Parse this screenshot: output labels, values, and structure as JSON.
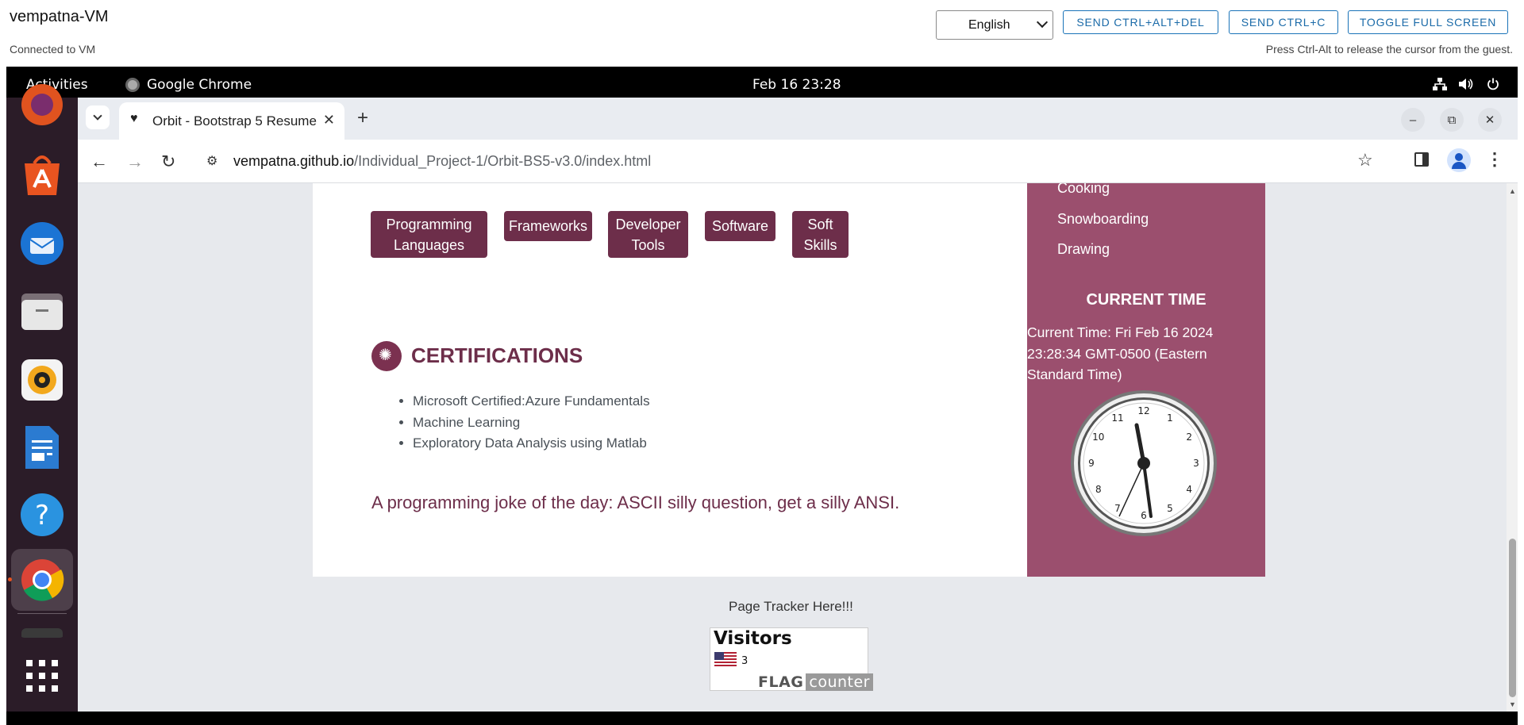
{
  "vm": {
    "title": "vempatna-VM",
    "status": "Connected to VM",
    "language": "English",
    "buttons": {
      "ctrl_alt_del": "SEND CTRL+ALT+DEL",
      "ctrl_c": "SEND CTRL+C",
      "fullscreen": "TOGGLE FULL SCREEN"
    },
    "hint": "Press Ctrl-Alt to release the cursor from the guest."
  },
  "topbar": {
    "activities": "Activities",
    "app_name": "Google Chrome",
    "datetime": "Feb 16  23:28"
  },
  "dock": {
    "items": [
      "firefox-icon",
      "app-center-icon",
      "thunderbird-icon",
      "files-icon",
      "rhythmbox-icon",
      "writer-icon",
      "help-icon",
      "chrome-icon",
      "terminal-icon",
      "app-grid-icon"
    ]
  },
  "browser": {
    "tab_title": "Orbit - Bootstrap 5 Resume",
    "url_host": "vempatna.github.io",
    "url_path": "/Individual_Project-1/Orbit-BS5-v3.0/index.html"
  },
  "page": {
    "skills": [
      {
        "line1": "Programming",
        "line2": "Languages"
      },
      {
        "line1": "Frameworks",
        "line2": ""
      },
      {
        "line1": "Developer",
        "line2": "Tools"
      },
      {
        "line1": "Software",
        "line2": ""
      },
      {
        "line1": "Soft",
        "line2": "Skills"
      }
    ],
    "certifications_heading": "CERTIFICATIONS",
    "certifications": [
      "Microsoft Certified:Azure Fundamentals",
      "Machine Learning",
      "Exploratory Data Analysis using Matlab"
    ],
    "joke": "A programming joke of the day: ASCII silly question, get a silly ANSI.",
    "hobbies": [
      "Cooking",
      "Snowboarding",
      "Drawing"
    ],
    "current_time_heading": "CURRENT TIME",
    "current_time_text": "Current Time: Fri Feb 16 2024 23:28:34 GMT-0500 (Eastern Standard Time)",
    "clock_numbers": [
      "12",
      "1",
      "2",
      "3",
      "4",
      "5",
      "6",
      "7",
      "8",
      "9",
      "10",
      "11"
    ],
    "tracker_label": "Page Tracker Here!!!",
    "flag_counter": {
      "title": "Visitors",
      "count": "3",
      "logo_a": "FLAG",
      "logo_b": "counter"
    }
  },
  "colors": {
    "accent": "#6d2e4a",
    "sidebar": "#9b4f6e",
    "dock": "#2b1c28"
  }
}
